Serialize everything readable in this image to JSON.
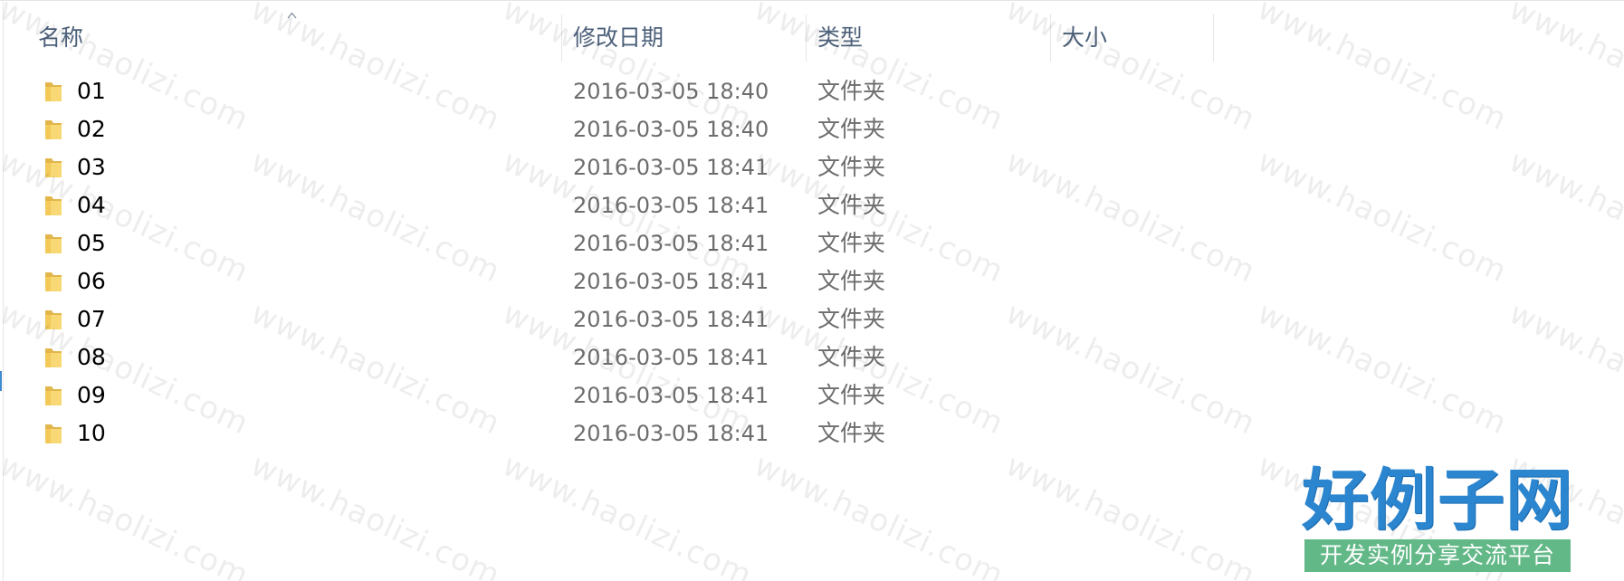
{
  "columns": {
    "name": "名称",
    "date": "修改日期",
    "type": "类型",
    "size": "大小"
  },
  "files": [
    {
      "name": "01",
      "date": "2016-03-05 18:40",
      "type": "文件夹",
      "icon": "folder-icon"
    },
    {
      "name": "02",
      "date": "2016-03-05 18:40",
      "type": "文件夹",
      "icon": "folder-icon"
    },
    {
      "name": "03",
      "date": "2016-03-05 18:41",
      "type": "文件夹",
      "icon": "folder-icon"
    },
    {
      "name": "04",
      "date": "2016-03-05 18:41",
      "type": "文件夹",
      "icon": "folder-icon"
    },
    {
      "name": "05",
      "date": "2016-03-05 18:41",
      "type": "文件夹",
      "icon": "folder-icon"
    },
    {
      "name": "06",
      "date": "2016-03-05 18:41",
      "type": "文件夹",
      "icon": "folder-icon"
    },
    {
      "name": "07",
      "date": "2016-03-05 18:41",
      "type": "文件夹",
      "icon": "folder-icon"
    },
    {
      "name": "08",
      "date": "2016-03-05 18:41",
      "type": "文件夹",
      "icon": "folder-icon"
    },
    {
      "name": "09",
      "date": "2016-03-05 18:41",
      "type": "文件夹",
      "icon": "folder-icon"
    },
    {
      "name": "10",
      "date": "2016-03-05 18:41",
      "type": "文件夹",
      "icon": "folder-icon"
    }
  ],
  "sort": {
    "column": "name",
    "direction": "ascending"
  },
  "watermark": {
    "text": "www.haolizi.com"
  },
  "logo": {
    "title": "好例子网",
    "subtitle": "开发实例分享交流平台"
  },
  "colors": {
    "header_text": "#4c607a",
    "folder": "#f8d775",
    "folder_dark": "#e2b64b",
    "logo_blue": "#2b86cf",
    "logo_green": "#63b888"
  }
}
